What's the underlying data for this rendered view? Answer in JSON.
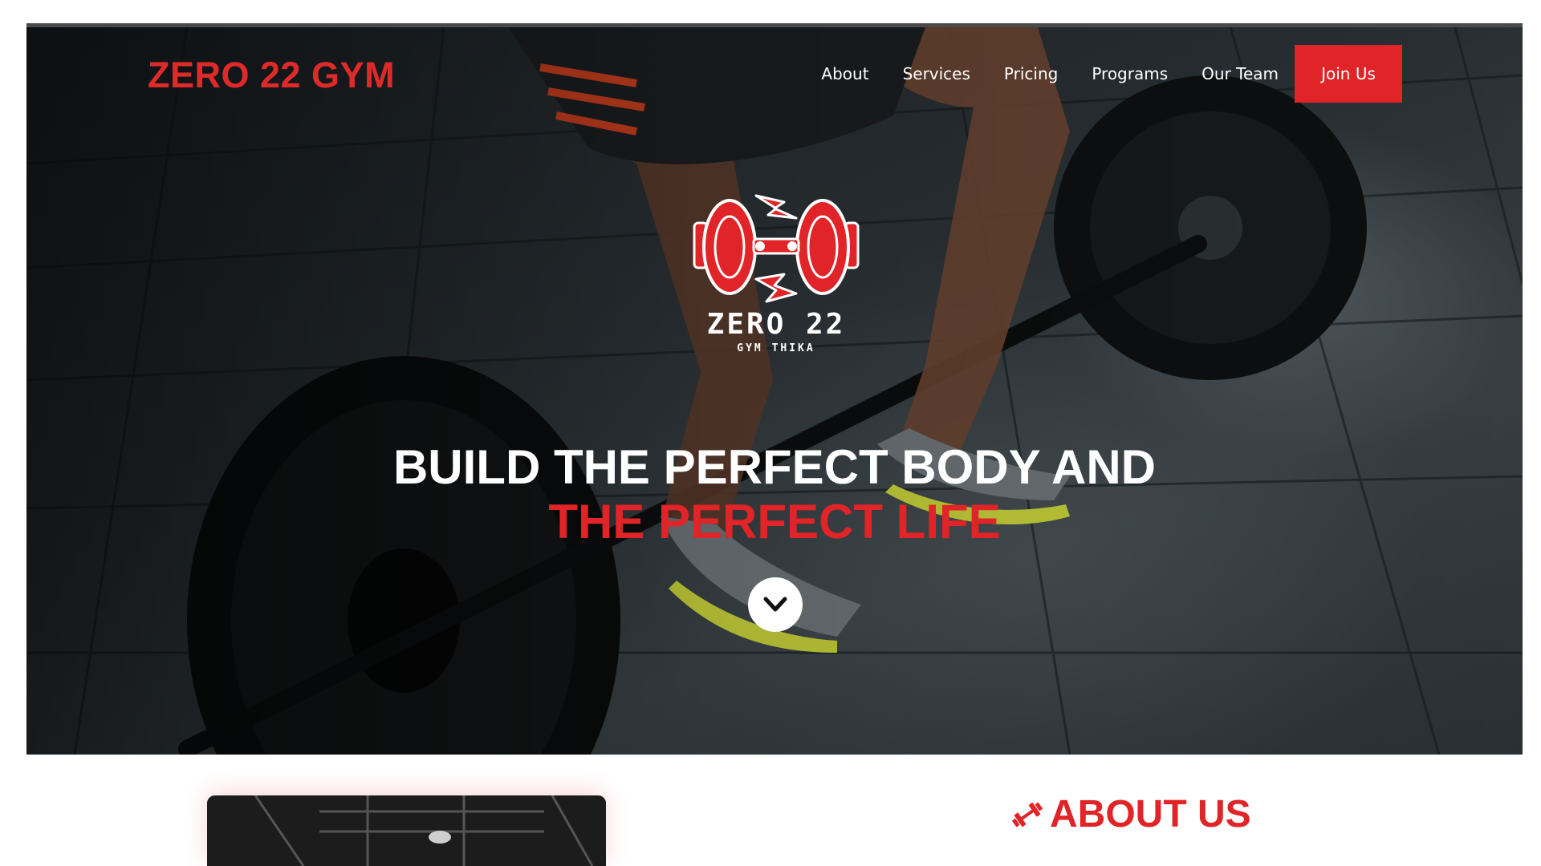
{
  "header": {
    "brand": "ZERO 22 GYM",
    "nav": [
      "About",
      "Services",
      "Pricing",
      "Programs",
      "Our Team"
    ],
    "cta": "Join Us"
  },
  "hero": {
    "logo_title": "ZERO 22",
    "logo_subtitle": "GYM THIKA",
    "headline_line1": "BUILD THE PERFECT BODY AND",
    "headline_line2": "THE PERFECT LIFE",
    "scroll_icon": "chevron-down-icon"
  },
  "about": {
    "icon": "dumbbell-icon",
    "heading": "ABOUT US"
  },
  "colors": {
    "accent": "#e02427",
    "hero_bg": "#2a3135",
    "text_light": "#ffffff"
  }
}
